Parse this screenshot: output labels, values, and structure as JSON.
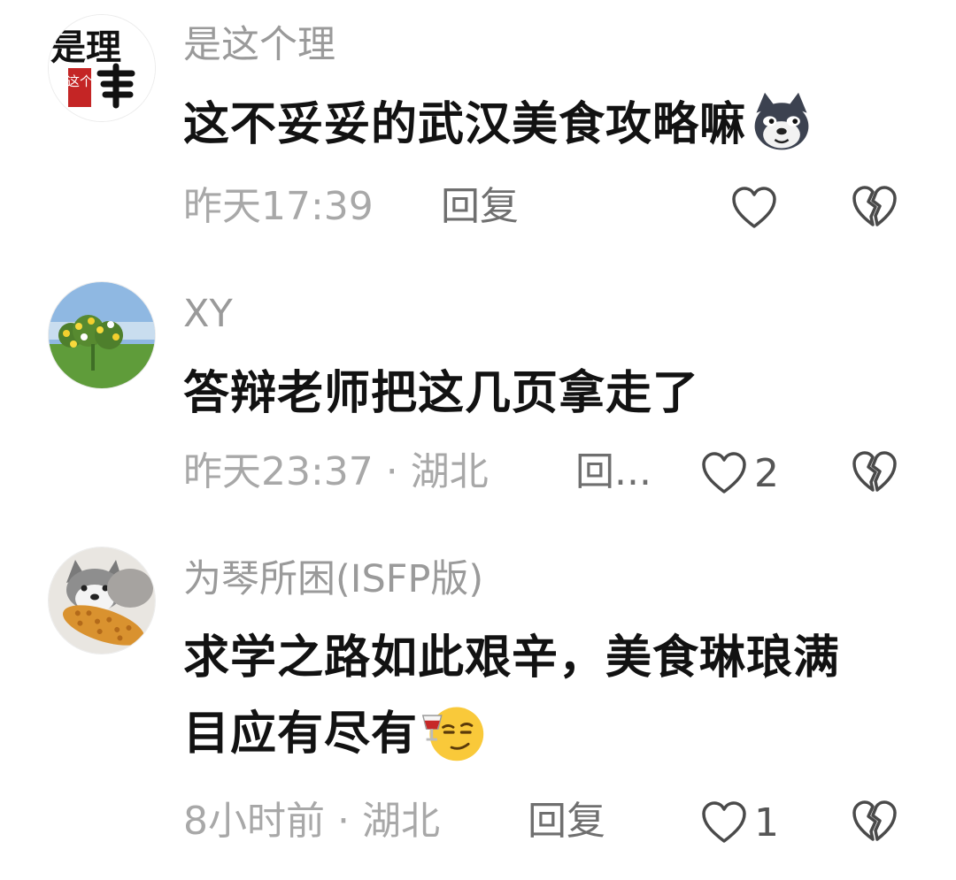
{
  "comments": [
    {
      "username": "是这个理",
      "avatar_icon": "calligraphy-seal-avatar",
      "avatar_text": "是理",
      "avatar_small_text": "这个",
      "lines": [
        "这不妥妥的武汉美食攻略嘛"
      ],
      "emoji_icon": "wolf-emoji",
      "time": "昨天17:39",
      "reply_label": "回复",
      "like_count": "",
      "colors": {
        "username": "#9a9a9a",
        "content": "#121212",
        "meta": "#a8a8a8"
      }
    },
    {
      "username": "XY",
      "avatar_icon": "flower-field-avatar",
      "lines": [
        "答辩老师把这几页拿走了"
      ],
      "time": "昨天23:37 · 湖北",
      "reply_label": "回...",
      "like_count": "2"
    },
    {
      "username": "为琴所困(ISFP版)",
      "avatar_icon": "dog-with-corn-avatar",
      "lines": [
        "求学之路如此艰辛，美食琳琅满",
        "目应有尽有"
      ],
      "emoji_icon": "smirk-wine-emoji",
      "time": "8小时前 · 湖北",
      "reply_label": "回复",
      "like_count": "1"
    }
  ],
  "icons": {
    "like": "heart-outline-icon",
    "dislike": "broken-heart-icon"
  }
}
